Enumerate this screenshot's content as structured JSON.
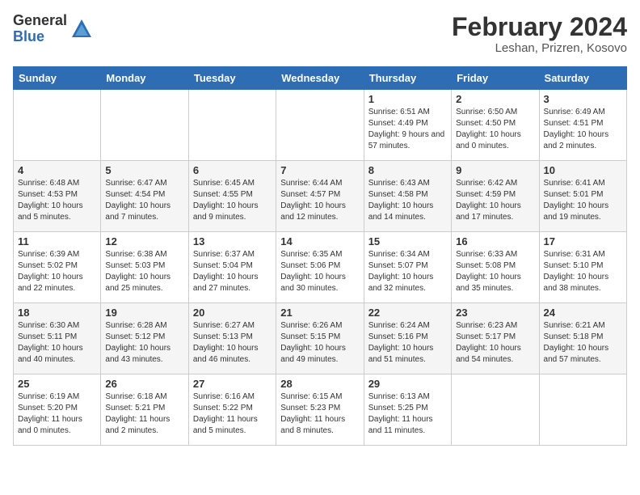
{
  "header": {
    "logo_general": "General",
    "logo_blue": "Blue",
    "month_title": "February 2024",
    "location": "Leshan, Prizren, Kosovo"
  },
  "weekdays": [
    "Sunday",
    "Monday",
    "Tuesday",
    "Wednesday",
    "Thursday",
    "Friday",
    "Saturday"
  ],
  "weeks": [
    [
      {
        "day": "",
        "info": ""
      },
      {
        "day": "",
        "info": ""
      },
      {
        "day": "",
        "info": ""
      },
      {
        "day": "",
        "info": ""
      },
      {
        "day": "1",
        "info": "Sunrise: 6:51 AM\nSunset: 4:49 PM\nDaylight: 9 hours and 57 minutes."
      },
      {
        "day": "2",
        "info": "Sunrise: 6:50 AM\nSunset: 4:50 PM\nDaylight: 10 hours and 0 minutes."
      },
      {
        "day": "3",
        "info": "Sunrise: 6:49 AM\nSunset: 4:51 PM\nDaylight: 10 hours and 2 minutes."
      }
    ],
    [
      {
        "day": "4",
        "info": "Sunrise: 6:48 AM\nSunset: 4:53 PM\nDaylight: 10 hours and 5 minutes."
      },
      {
        "day": "5",
        "info": "Sunrise: 6:47 AM\nSunset: 4:54 PM\nDaylight: 10 hours and 7 minutes."
      },
      {
        "day": "6",
        "info": "Sunrise: 6:45 AM\nSunset: 4:55 PM\nDaylight: 10 hours and 9 minutes."
      },
      {
        "day": "7",
        "info": "Sunrise: 6:44 AM\nSunset: 4:57 PM\nDaylight: 10 hours and 12 minutes."
      },
      {
        "day": "8",
        "info": "Sunrise: 6:43 AM\nSunset: 4:58 PM\nDaylight: 10 hours and 14 minutes."
      },
      {
        "day": "9",
        "info": "Sunrise: 6:42 AM\nSunset: 4:59 PM\nDaylight: 10 hours and 17 minutes."
      },
      {
        "day": "10",
        "info": "Sunrise: 6:41 AM\nSunset: 5:01 PM\nDaylight: 10 hours and 19 minutes."
      }
    ],
    [
      {
        "day": "11",
        "info": "Sunrise: 6:39 AM\nSunset: 5:02 PM\nDaylight: 10 hours and 22 minutes."
      },
      {
        "day": "12",
        "info": "Sunrise: 6:38 AM\nSunset: 5:03 PM\nDaylight: 10 hours and 25 minutes."
      },
      {
        "day": "13",
        "info": "Sunrise: 6:37 AM\nSunset: 5:04 PM\nDaylight: 10 hours and 27 minutes."
      },
      {
        "day": "14",
        "info": "Sunrise: 6:35 AM\nSunset: 5:06 PM\nDaylight: 10 hours and 30 minutes."
      },
      {
        "day": "15",
        "info": "Sunrise: 6:34 AM\nSunset: 5:07 PM\nDaylight: 10 hours and 32 minutes."
      },
      {
        "day": "16",
        "info": "Sunrise: 6:33 AM\nSunset: 5:08 PM\nDaylight: 10 hours and 35 minutes."
      },
      {
        "day": "17",
        "info": "Sunrise: 6:31 AM\nSunset: 5:10 PM\nDaylight: 10 hours and 38 minutes."
      }
    ],
    [
      {
        "day": "18",
        "info": "Sunrise: 6:30 AM\nSunset: 5:11 PM\nDaylight: 10 hours and 40 minutes."
      },
      {
        "day": "19",
        "info": "Sunrise: 6:28 AM\nSunset: 5:12 PM\nDaylight: 10 hours and 43 minutes."
      },
      {
        "day": "20",
        "info": "Sunrise: 6:27 AM\nSunset: 5:13 PM\nDaylight: 10 hours and 46 minutes."
      },
      {
        "day": "21",
        "info": "Sunrise: 6:26 AM\nSunset: 5:15 PM\nDaylight: 10 hours and 49 minutes."
      },
      {
        "day": "22",
        "info": "Sunrise: 6:24 AM\nSunset: 5:16 PM\nDaylight: 10 hours and 51 minutes."
      },
      {
        "day": "23",
        "info": "Sunrise: 6:23 AM\nSunset: 5:17 PM\nDaylight: 10 hours and 54 minutes."
      },
      {
        "day": "24",
        "info": "Sunrise: 6:21 AM\nSunset: 5:18 PM\nDaylight: 10 hours and 57 minutes."
      }
    ],
    [
      {
        "day": "25",
        "info": "Sunrise: 6:19 AM\nSunset: 5:20 PM\nDaylight: 11 hours and 0 minutes."
      },
      {
        "day": "26",
        "info": "Sunrise: 6:18 AM\nSunset: 5:21 PM\nDaylight: 11 hours and 2 minutes."
      },
      {
        "day": "27",
        "info": "Sunrise: 6:16 AM\nSunset: 5:22 PM\nDaylight: 11 hours and 5 minutes."
      },
      {
        "day": "28",
        "info": "Sunrise: 6:15 AM\nSunset: 5:23 PM\nDaylight: 11 hours and 8 minutes."
      },
      {
        "day": "29",
        "info": "Sunrise: 6:13 AM\nSunset: 5:25 PM\nDaylight: 11 hours and 11 minutes."
      },
      {
        "day": "",
        "info": ""
      },
      {
        "day": "",
        "info": ""
      }
    ]
  ]
}
